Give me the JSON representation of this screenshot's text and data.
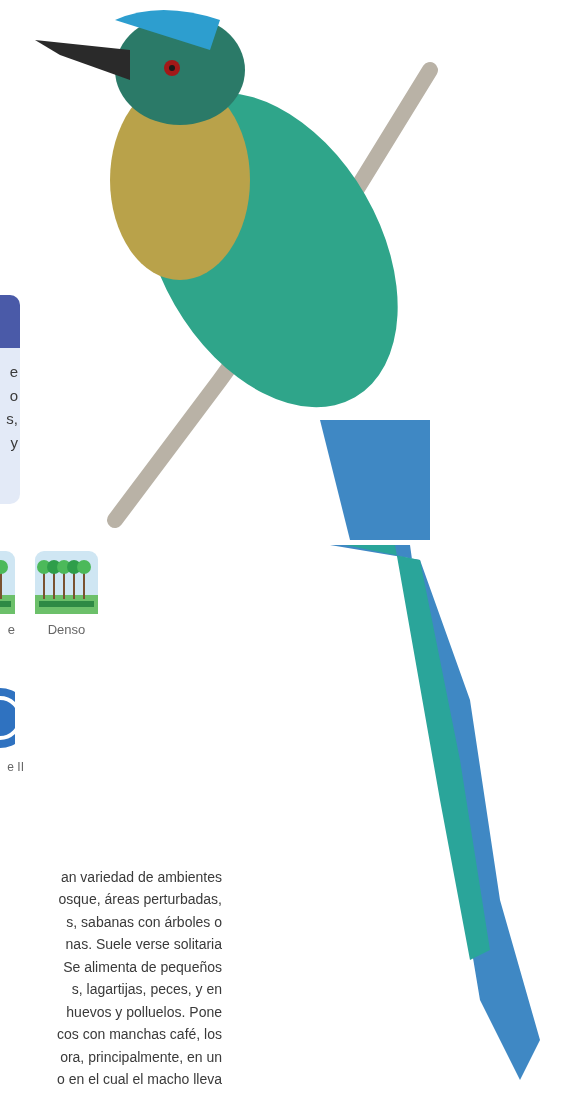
{
  "info_card": {
    "lines": [
      "e",
      "o",
      "s,",
      "y"
    ]
  },
  "habitat_options": [
    {
      "label": "e",
      "clipped": true
    },
    {
      "label": "Denso",
      "clipped": false
    }
  ],
  "status_badge": {
    "label": "e II"
  },
  "description": {
    "lines": [
      "an variedad de ambientes",
      "osque, áreas perturbadas,",
      "s, sabanas con árboles o",
      "nas. Suele verse solitaria",
      "Se alimenta de pequeños",
      "s, lagartijas, peces, y en",
      "huevos y polluelos. Pone",
      "cos con manchas café, los",
      "ora, principalmente, en un",
      "o en el cual el macho lleva"
    ]
  }
}
